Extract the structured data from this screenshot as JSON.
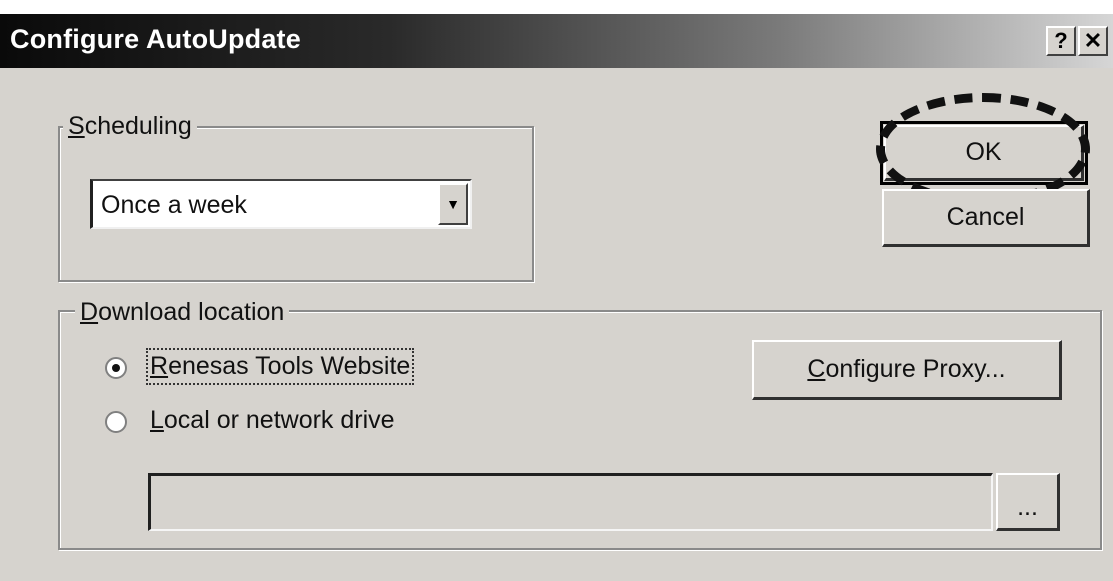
{
  "window": {
    "title": "Configure AutoUpdate",
    "help_label": "?",
    "close_label": "✕"
  },
  "scheduling": {
    "label_accel": "S",
    "label_rest": "cheduling",
    "selected_value": "Once a week"
  },
  "buttons": {
    "ok": "OK",
    "cancel": "Cancel",
    "proxy_accel": "C",
    "proxy_rest": "onfigure Proxy...",
    "browse": "..."
  },
  "download": {
    "label_accel": "D",
    "label_rest": "ownload location",
    "options": [
      {
        "accel": "R",
        "rest": "enesas Tools Website",
        "checked": true
      },
      {
        "accel": "L",
        "rest": "ocal or network drive",
        "checked": false
      }
    ],
    "path_value": ""
  }
}
